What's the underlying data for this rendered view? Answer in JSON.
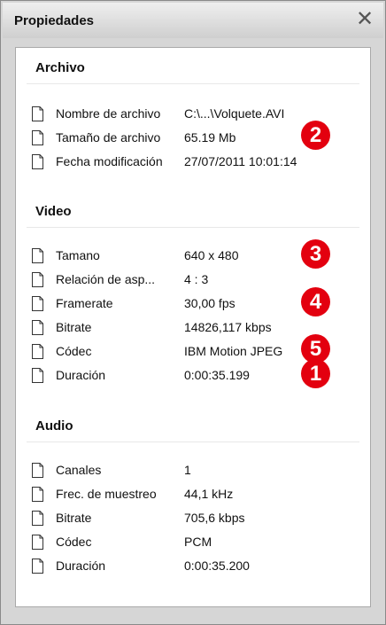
{
  "window": {
    "title": "Propiedades",
    "close_icon": "close-icon"
  },
  "sections": {
    "archivo": {
      "title": "Archivo",
      "rows": [
        {
          "label": "Nombre de archivo",
          "value": "C:\\...\\Volquete.AVI"
        },
        {
          "label": "Tamaño de archivo",
          "value": "65.19 Mb"
        },
        {
          "label": "Fecha modificación",
          "value": "27/07/2011 10:01:14"
        }
      ]
    },
    "video": {
      "title": "Video",
      "rows": [
        {
          "label": "Tamano",
          "value": "640 x 480"
        },
        {
          "label": "Relación de asp...",
          "value": "4 : 3"
        },
        {
          "label": "Framerate",
          "value": "30,00 fps"
        },
        {
          "label": "Bitrate",
          "value": "14826,117 kbps"
        },
        {
          "label": "Códec",
          "value": "IBM Motion JPEG"
        },
        {
          "label": "Duración",
          "value": "0:00:35.199"
        }
      ]
    },
    "audio": {
      "title": "Audio",
      "rows": [
        {
          "label": "Canales",
          "value": "1"
        },
        {
          "label": "Frec. de muestreo",
          "value": "44,1 kHz"
        },
        {
          "label": "Bitrate",
          "value": "705,6 kbps"
        },
        {
          "label": "Códec",
          "value": "PCM"
        },
        {
          "label": "Duración",
          "value": "0:00:35.200"
        }
      ]
    }
  },
  "badges": [
    "2",
    "3",
    "4",
    "5",
    "1"
  ],
  "colors": {
    "badge": "#e3000f",
    "frame": "#d6d6d6"
  }
}
